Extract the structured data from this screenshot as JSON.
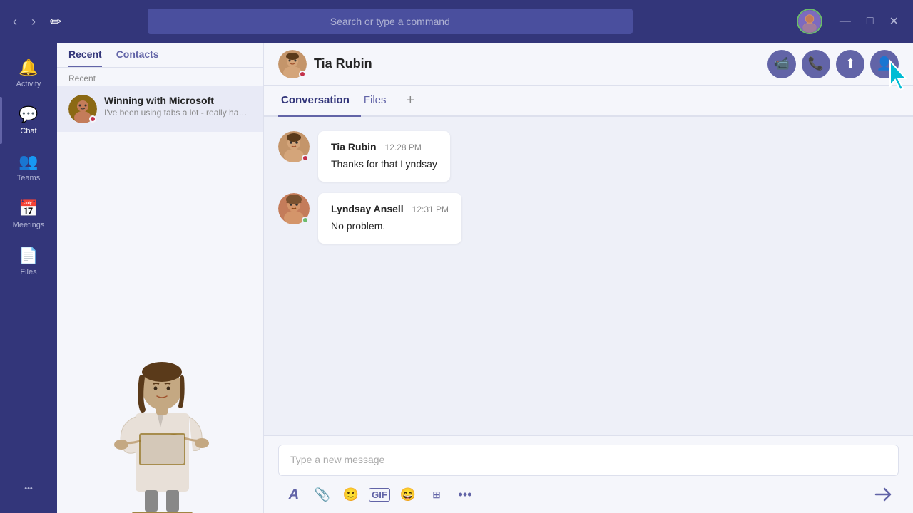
{
  "titlebar": {
    "search_placeholder": "Search or type a command",
    "nav_back": "‹",
    "nav_forward": "›",
    "compose_icon": "✎",
    "window_min": "—",
    "window_max": "□",
    "window_close": "✕"
  },
  "sidebar": {
    "items": [
      {
        "id": "activity",
        "label": "Activity",
        "icon": "🔔"
      },
      {
        "id": "chat",
        "label": "Chat",
        "icon": "💬",
        "active": true
      },
      {
        "id": "teams",
        "label": "Teams",
        "icon": "👥"
      },
      {
        "id": "meetings",
        "label": "Meetings",
        "icon": "📅"
      },
      {
        "id": "files",
        "label": "Files",
        "icon": "📄"
      }
    ],
    "more_label": "•••"
  },
  "chat_list": {
    "tabs": [
      {
        "id": "recent",
        "label": "Recent",
        "active": true
      },
      {
        "id": "contacts",
        "label": "Contacts"
      }
    ],
    "recent_label": "Recent",
    "items": [
      {
        "name": "Winning with Microsoft",
        "preview": "I've been using tabs a lot - really handy.",
        "status": "busy"
      }
    ]
  },
  "chat_header": {
    "name": "Tia Rubin",
    "actions": [
      {
        "id": "video",
        "icon": "📹"
      },
      {
        "id": "phone",
        "icon": "📞"
      },
      {
        "id": "share",
        "icon": "⬆"
      },
      {
        "id": "people",
        "icon": "👤+"
      }
    ]
  },
  "tabs": [
    {
      "id": "conversation",
      "label": "Conversation",
      "active": true
    },
    {
      "id": "files",
      "label": "Files"
    }
  ],
  "messages": [
    {
      "sender": "Tia Rubin",
      "time": "12.28 PM",
      "text": "Thanks for that Lyndsay",
      "avatar": "tia",
      "status": "busy"
    },
    {
      "sender": "Lyndsay Ansell",
      "time": "12:31 PM",
      "text": "No problem.",
      "avatar": "lyndsay",
      "status": "available"
    }
  ],
  "message_input": {
    "placeholder": "Type a new message"
  },
  "toolbar": {
    "format_icon": "A",
    "attach_icon": "🖇",
    "emoji_icon": "😊",
    "gif_label": "GIF",
    "sticker_icon": "🗂",
    "meet_icon": "⬛",
    "more_icon": "•••",
    "send_icon": "➤"
  }
}
